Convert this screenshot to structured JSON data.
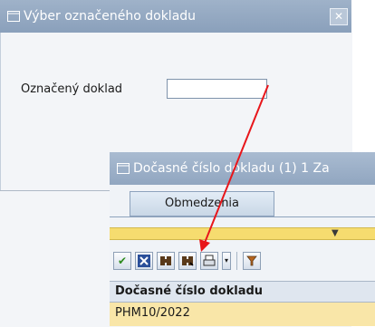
{
  "dialog1": {
    "title": "Výber označeného dokladu",
    "field_label": "Označený doklad",
    "field_value": ""
  },
  "dialog2": {
    "title": "Dočasné číslo dokladu (1)   1 Za",
    "tab_label": "Obmedzenia",
    "toolbar_icons": [
      "check-icon",
      "cancel-icon",
      "find-icon",
      "find-next-icon",
      "print-icon",
      "dropdown-icon",
      "filter-icon"
    ],
    "column_header": "Dočasné číslo dokladu",
    "rows": [
      "PHM10/2022"
    ]
  },
  "colors": {
    "title_bar": "#8aa0bb",
    "selection_bar": "#f6dc6f",
    "row_highlight": "#f9e6a8",
    "annotation_arrow": "#e8161b"
  }
}
